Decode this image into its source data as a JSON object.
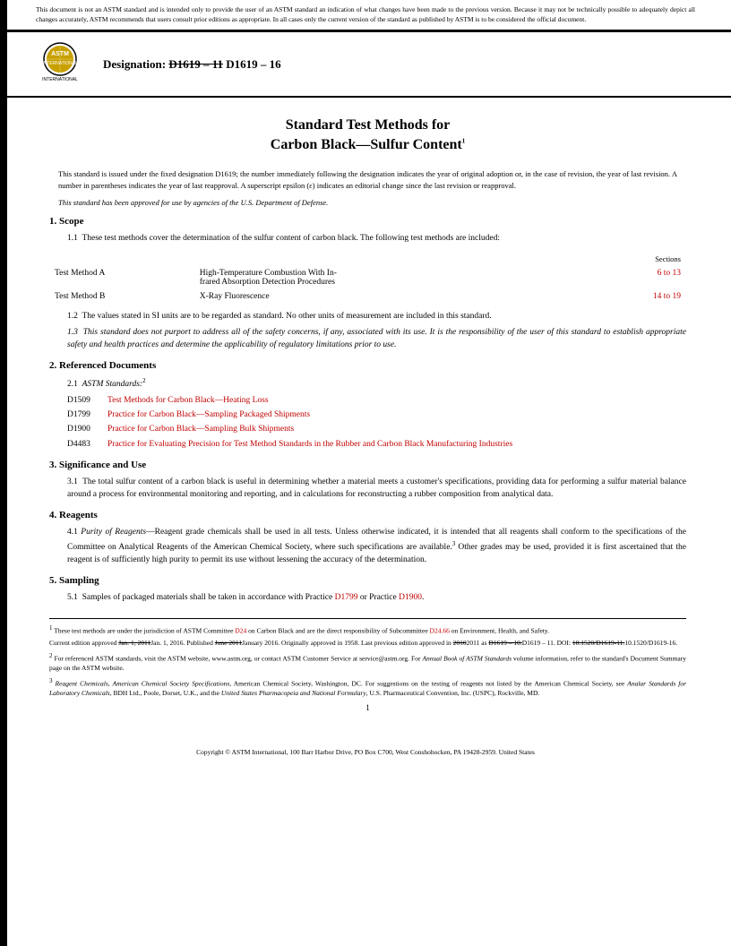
{
  "topNotice": {
    "text": "This document is not an ASTM standard and is intended only to provide the user of an ASTM standard an indication of what changes have been made to the previous version. Because it may not be technically possible to adequately depict all changes accurately, ASTM recommends that users consult prior editions as appropriate. In all cases only the current version of the standard as published by ASTM is to be considered the official document."
  },
  "header": {
    "designationLabel": "Designation:",
    "designationOld": "D1619 – 11",
    "designationNew": "D1619 – 16"
  },
  "title": {
    "line1": "Standard Test Methods for",
    "line2": "Carbon Black—Sulfur Content",
    "superscript": "1"
  },
  "introBox": {
    "text": "This standard is issued under the fixed designation D1619; the number immediately following the designation indicates the year of original adoption or, in the case of revision, the year of last revision. A number in parentheses indicates the year of last reapproval. A superscript epsilon (ε) indicates an editorial change since the last revision or reapproval.",
    "italic": "This standard has been approved for use by agencies of the U.S. Department of Defense."
  },
  "sections": {
    "scope": {
      "number": "1.",
      "title": "Scope",
      "para1": {
        "num": "1.1",
        "text": "These test methods cover the determination of the sulfur content of carbon black. The following test methods are included:"
      },
      "testMethods": {
        "sectionsHeader": "Sections",
        "rows": [
          {
            "label": "Test Method A",
            "description": "High-Temperature Combustion With Infrared Absorption Detection Procedures",
            "sections": "6 to 13"
          },
          {
            "label": "Test Method B",
            "description": "X-Ray Fluorescence",
            "sections": "14 to 19"
          }
        ]
      },
      "para2": {
        "num": "1.2",
        "text": "The values stated in SI units are to be regarded as standard. No other units of measurement are included in this standard."
      },
      "para3": {
        "num": "1.3",
        "text": "This standard does not purport to address all of the safety concerns, if any, associated with its use. It is the responsibility of the user of this standard to establish appropriate safety and health practices and determine the applicability of regulatory limitations prior to use."
      }
    },
    "referencedDocuments": {
      "number": "2.",
      "title": "Referenced Documents",
      "para1": {
        "num": "2.1",
        "label": "ASTM Standards:",
        "superscript": "2"
      },
      "refs": [
        {
          "num": "D1509",
          "text": "Test Methods for Carbon Black—Heating Loss",
          "link": true
        },
        {
          "num": "D1799",
          "text": "Practice for Carbon Black—Sampling Packaged Shipments",
          "link": true
        },
        {
          "num": "D1900",
          "text": "Practice for Carbon Black—Sampling Bulk Shipments",
          "link": true
        },
        {
          "num": "D4483",
          "text": "Practice for Evaluating Precision for Test Method Standards in the Rubber and Carbon Black Manufacturing Industries",
          "link": true
        }
      ]
    },
    "significanceAndUse": {
      "number": "3.",
      "title": "Significance and Use",
      "para1": {
        "num": "3.1",
        "text": "The total sulfur content of a carbon black is useful in determining whether a material meets a customer's specifications, providing data for performing a sulfur material balance around a process for environmental monitoring and reporting, and in calculations for reconstructing a rubber composition from analytical data."
      }
    },
    "reagents": {
      "number": "4.",
      "title": "Reagents",
      "para1": {
        "num": "4.1",
        "label": "Purity of Reagents",
        "text": "—Reagent grade chemicals shall be used in all tests. Unless otherwise indicated, it is intended that all reagents shall conform to the specifications of the Committee on Analytical Reagents of the American Chemical Society, where such specifications are available.",
        "superscript": "3",
        "text2": " Other grades may be used, provided it is first ascertained that the reagent is of sufficiently high purity to permit its use without lessening the accuracy of the determination."
      }
    },
    "sampling": {
      "number": "5.",
      "title": "Sampling",
      "para1": {
        "num": "5.1",
        "text": "Samples of packaged materials shall be taken in accordance with Practice",
        "link1": "D1799",
        "or": "or Practice",
        "link2": "D1900",
        "end": "."
      }
    }
  },
  "footnotes": {
    "fn1": {
      "text": "These test methods are under the jurisdiction of ASTM Committee",
      "link1": "D24",
      "text2": "on Carbon Black and are the direct responsibility of Subcommittee",
      "link2": "D24.66",
      "text3": "on Environment, Health, and Safety."
    },
    "fn1current": "Current edition approved Jan. 1, 2011Jan. 1, 2016. Published June 2011January 2016. Originally approved in 1958. Last previous edition approved in 20102011 as D1619 – 10.D1619 – 11. DOI: 10.1520/D1619-11.10.1520/D1619-16.",
    "fn2": "For referenced ASTM standards, visit the ASTM website, www.astm.org, or contact ASTM Customer Service at service@astm.org. For Annual Book of ASTM Standards volume information, refer to the standard's Document Summary page on the ASTM website.",
    "fn3": "Reagent Chemicals, American Chemical Society Specifications, American Chemical Society, Washington, DC. For suggestions on the testing of reagents not listed by the American Chemical Society, see Analar Standards for Laboratory Chemicals, BDH Ltd., Poole, Dorset, U.K., and the United States Pharmacopeia and National Formulary, U.S. Pharmaceutical Convention, Inc. (USPC), Rockville, MD."
  },
  "copyright": "Copyright © ASTM International, 100 Barr Harbor Drive, PO Box C700, West Conshohocken, PA 19428-2959. United States",
  "pageNumber": "1"
}
